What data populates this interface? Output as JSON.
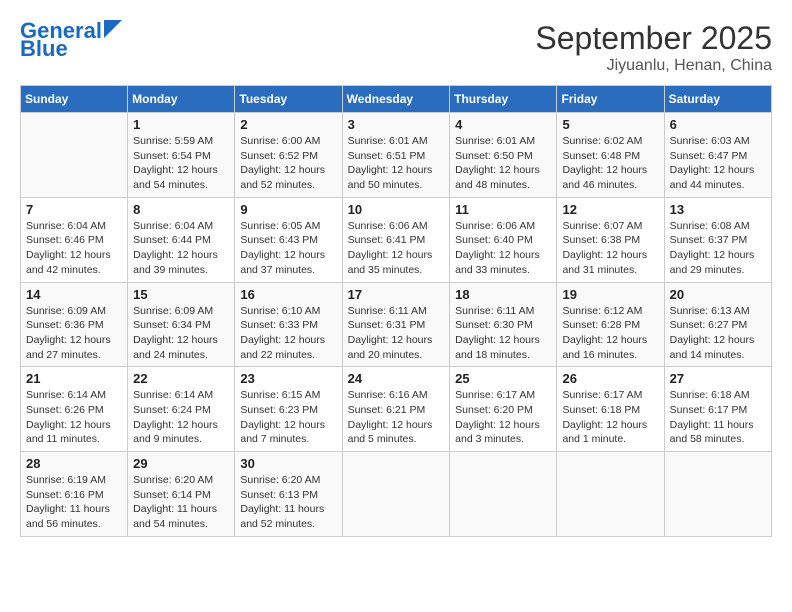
{
  "header": {
    "logo_line1": "General",
    "logo_line2": "Blue",
    "title": "September 2025",
    "subtitle": "Jiyuanlu, Henan, China"
  },
  "columns": [
    "Sunday",
    "Monday",
    "Tuesday",
    "Wednesday",
    "Thursday",
    "Friday",
    "Saturday"
  ],
  "weeks": [
    [
      {
        "date": "",
        "info": ""
      },
      {
        "date": "1",
        "info": "Sunrise: 5:59 AM\nSunset: 6:54 PM\nDaylight: 12 hours\nand 54 minutes."
      },
      {
        "date": "2",
        "info": "Sunrise: 6:00 AM\nSunset: 6:52 PM\nDaylight: 12 hours\nand 52 minutes."
      },
      {
        "date": "3",
        "info": "Sunrise: 6:01 AM\nSunset: 6:51 PM\nDaylight: 12 hours\nand 50 minutes."
      },
      {
        "date": "4",
        "info": "Sunrise: 6:01 AM\nSunset: 6:50 PM\nDaylight: 12 hours\nand 48 minutes."
      },
      {
        "date": "5",
        "info": "Sunrise: 6:02 AM\nSunset: 6:48 PM\nDaylight: 12 hours\nand 46 minutes."
      },
      {
        "date": "6",
        "info": "Sunrise: 6:03 AM\nSunset: 6:47 PM\nDaylight: 12 hours\nand 44 minutes."
      }
    ],
    [
      {
        "date": "7",
        "info": "Sunrise: 6:04 AM\nSunset: 6:46 PM\nDaylight: 12 hours\nand 42 minutes."
      },
      {
        "date": "8",
        "info": "Sunrise: 6:04 AM\nSunset: 6:44 PM\nDaylight: 12 hours\nand 39 minutes."
      },
      {
        "date": "9",
        "info": "Sunrise: 6:05 AM\nSunset: 6:43 PM\nDaylight: 12 hours\nand 37 minutes."
      },
      {
        "date": "10",
        "info": "Sunrise: 6:06 AM\nSunset: 6:41 PM\nDaylight: 12 hours\nand 35 minutes."
      },
      {
        "date": "11",
        "info": "Sunrise: 6:06 AM\nSunset: 6:40 PM\nDaylight: 12 hours\nand 33 minutes."
      },
      {
        "date": "12",
        "info": "Sunrise: 6:07 AM\nSunset: 6:38 PM\nDaylight: 12 hours\nand 31 minutes."
      },
      {
        "date": "13",
        "info": "Sunrise: 6:08 AM\nSunset: 6:37 PM\nDaylight: 12 hours\nand 29 minutes."
      }
    ],
    [
      {
        "date": "14",
        "info": "Sunrise: 6:09 AM\nSunset: 6:36 PM\nDaylight: 12 hours\nand 27 minutes."
      },
      {
        "date": "15",
        "info": "Sunrise: 6:09 AM\nSunset: 6:34 PM\nDaylight: 12 hours\nand 24 minutes."
      },
      {
        "date": "16",
        "info": "Sunrise: 6:10 AM\nSunset: 6:33 PM\nDaylight: 12 hours\nand 22 minutes."
      },
      {
        "date": "17",
        "info": "Sunrise: 6:11 AM\nSunset: 6:31 PM\nDaylight: 12 hours\nand 20 minutes."
      },
      {
        "date": "18",
        "info": "Sunrise: 6:11 AM\nSunset: 6:30 PM\nDaylight: 12 hours\nand 18 minutes."
      },
      {
        "date": "19",
        "info": "Sunrise: 6:12 AM\nSunset: 6:28 PM\nDaylight: 12 hours\nand 16 minutes."
      },
      {
        "date": "20",
        "info": "Sunrise: 6:13 AM\nSunset: 6:27 PM\nDaylight: 12 hours\nand 14 minutes."
      }
    ],
    [
      {
        "date": "21",
        "info": "Sunrise: 6:14 AM\nSunset: 6:26 PM\nDaylight: 12 hours\nand 11 minutes."
      },
      {
        "date": "22",
        "info": "Sunrise: 6:14 AM\nSunset: 6:24 PM\nDaylight: 12 hours\nand 9 minutes."
      },
      {
        "date": "23",
        "info": "Sunrise: 6:15 AM\nSunset: 6:23 PM\nDaylight: 12 hours\nand 7 minutes."
      },
      {
        "date": "24",
        "info": "Sunrise: 6:16 AM\nSunset: 6:21 PM\nDaylight: 12 hours\nand 5 minutes."
      },
      {
        "date": "25",
        "info": "Sunrise: 6:17 AM\nSunset: 6:20 PM\nDaylight: 12 hours\nand 3 minutes."
      },
      {
        "date": "26",
        "info": "Sunrise: 6:17 AM\nSunset: 6:18 PM\nDaylight: 12 hours\nand 1 minute."
      },
      {
        "date": "27",
        "info": "Sunrise: 6:18 AM\nSunset: 6:17 PM\nDaylight: 11 hours\nand 58 minutes."
      }
    ],
    [
      {
        "date": "28",
        "info": "Sunrise: 6:19 AM\nSunset: 6:16 PM\nDaylight: 11 hours\nand 56 minutes."
      },
      {
        "date": "29",
        "info": "Sunrise: 6:20 AM\nSunset: 6:14 PM\nDaylight: 11 hours\nand 54 minutes."
      },
      {
        "date": "30",
        "info": "Sunrise: 6:20 AM\nSunset: 6:13 PM\nDaylight: 11 hours\nand 52 minutes."
      },
      {
        "date": "",
        "info": ""
      },
      {
        "date": "",
        "info": ""
      },
      {
        "date": "",
        "info": ""
      },
      {
        "date": "",
        "info": ""
      }
    ]
  ]
}
